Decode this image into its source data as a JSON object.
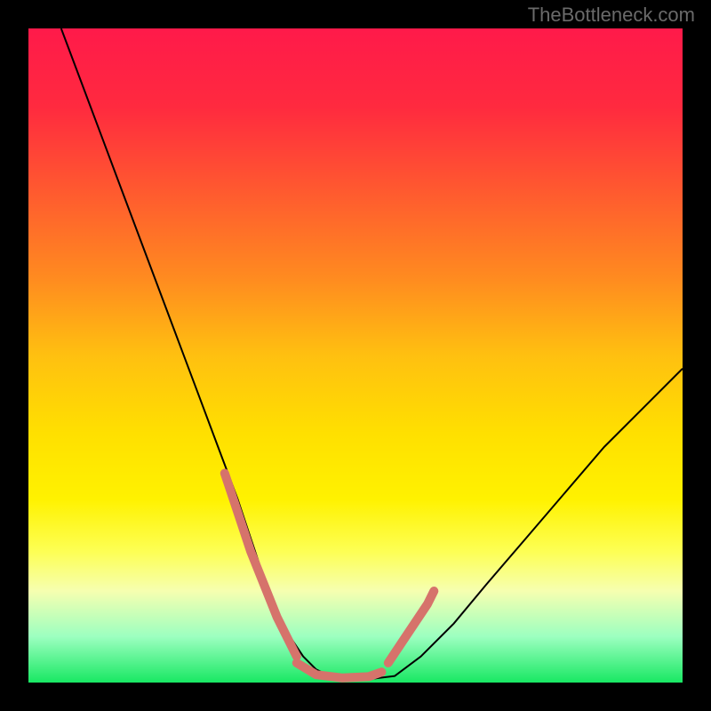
{
  "watermark": "TheBottleneck.com",
  "chart_data": {
    "type": "line",
    "title": "",
    "xlabel": "",
    "ylabel": "",
    "xlim": [
      0,
      100
    ],
    "ylim": [
      0,
      100
    ],
    "background_gradient": {
      "stops": [
        {
          "offset": 0.0,
          "color": "#ff1a4a"
        },
        {
          "offset": 0.12,
          "color": "#ff2a3f"
        },
        {
          "offset": 0.25,
          "color": "#ff5a2f"
        },
        {
          "offset": 0.38,
          "color": "#ff8a20"
        },
        {
          "offset": 0.5,
          "color": "#ffc010"
        },
        {
          "offset": 0.62,
          "color": "#ffe000"
        },
        {
          "offset": 0.72,
          "color": "#fff200"
        },
        {
          "offset": 0.8,
          "color": "#fdff55"
        },
        {
          "offset": 0.86,
          "color": "#f6ffb0"
        },
        {
          "offset": 0.93,
          "color": "#9cffc0"
        },
        {
          "offset": 1.0,
          "color": "#18e863"
        }
      ]
    },
    "series": [
      {
        "name": "bottleneck-curve",
        "stroke": "#000000",
        "stroke_width": 2,
        "x": [
          5,
          8,
          11,
          14,
          17,
          20,
          23,
          26,
          29,
          32,
          34,
          36,
          38,
          40,
          42,
          44,
          46,
          48,
          52,
          56,
          60,
          65,
          70,
          76,
          82,
          88,
          94,
          100
        ],
        "y": [
          100,
          92,
          84,
          76,
          68,
          60,
          52,
          44,
          36,
          28,
          22,
          16,
          11,
          7,
          4,
          2,
          1,
          0.5,
          0.5,
          1,
          4,
          9,
          15,
          22,
          29,
          36,
          42,
          48
        ]
      }
    ],
    "highlight_segments": [
      {
        "name": "left-descent-marker",
        "stroke": "#d6736b",
        "stroke_width": 10,
        "x": [
          30,
          32,
          34,
          36,
          38,
          40,
          41
        ],
        "y": [
          32,
          26,
          20,
          15,
          10,
          6,
          4
        ]
      },
      {
        "name": "valley-floor-marker",
        "stroke": "#d6736b",
        "stroke_width": 10,
        "x": [
          41,
          44,
          48,
          52,
          54
        ],
        "y": [
          3,
          1.2,
          0.7,
          0.9,
          1.6
        ]
      },
      {
        "name": "right-ascent-marker",
        "stroke": "#d6736b",
        "stroke_width": 10,
        "x": [
          55,
          57,
          59,
          61,
          62
        ],
        "y": [
          3,
          6,
          9,
          12,
          14
        ]
      }
    ]
  }
}
